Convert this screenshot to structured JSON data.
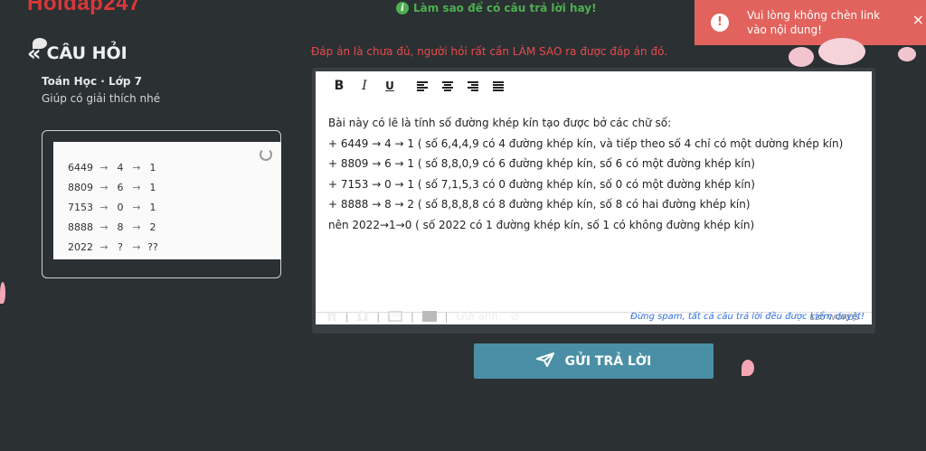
{
  "header": {
    "logo": "Hoidap247",
    "tip": "Làm sao để có câu trả lời hay!"
  },
  "toast": {
    "message": "Vui lòng không chèn link vào nội dung!",
    "alert_icon": "alert-circle-icon",
    "close_icon": "close-icon"
  },
  "question": {
    "section_title": "CÂU HỎI",
    "subject": "Toán Học · Lớp 7",
    "description": "Giúp có giải thích nhé",
    "image_rows": [
      {
        "a": "6449",
        "arrow1": "→",
        "b": "4",
        "arrow2": "→",
        "c": "1"
      },
      {
        "a": "8809",
        "arrow1": "→",
        "b": "6",
        "arrow2": "→",
        "c": "1"
      },
      {
        "a": "7153",
        "arrow1": "→",
        "b": "0",
        "arrow2": "→",
        "c": "1"
      },
      {
        "a": "8888",
        "arrow1": "→",
        "b": "8",
        "arrow2": "→",
        "c": "2"
      },
      {
        "a": "2022",
        "arrow1": "→",
        "b": "?",
        "arrow2": "→",
        "c": "??"
      }
    ]
  },
  "answer": {
    "warning": "Đáp án là chưa đủ, người hỏi rất cần LÀM SAO ra được đáp án đó.",
    "toolbar": {
      "bold": "B",
      "italic": "I",
      "underline": "U"
    },
    "content": [
      "Bài này có lẽ là tính số đường khép kín tạo được bở các chữ số:",
      "+ 6449 → 4 → 1 ( số 6,4,4,9 có 4 đường khép kín, và tiếp theo số 4 chỉ có một dường khép kín)",
      "+ 8809 → 6 → 1 ( số 8,8,0,9 có 6 đường khép kín, số 6 có một đường khép kín)",
      "+ 7153 → 0 → 1 ( số 7,1,5,3 có 0 đường khép kín, số 0 có một đường khép kín)",
      "+ 8888 → 8 → 2 ( số 8,8,8,8 có 8 đường khép kín, số 8 có hai đường khép kín)",
      "nên 2022→1→0 ( số 2022 có 1 đường khép kín, số 1 có không đường khép kín)"
    ],
    "word_count": "120 WORDS",
    "bottom_tools": {
      "pi": "π",
      "omega": "Ω",
      "send_image": "Gửi ảnh:"
    },
    "spam_note": "Đừng spam, tất cả câu trả lời đều được kiểm duyệt!",
    "submit_label": "GỬI TRẢ LỜI"
  },
  "colors": {
    "background": "#2b3033",
    "accent_red": "#e84a4a",
    "toast": "#e2635d",
    "submit": "#4a8fa6",
    "tip_green": "#4caf50",
    "spam_blue": "#2f6fe0"
  }
}
